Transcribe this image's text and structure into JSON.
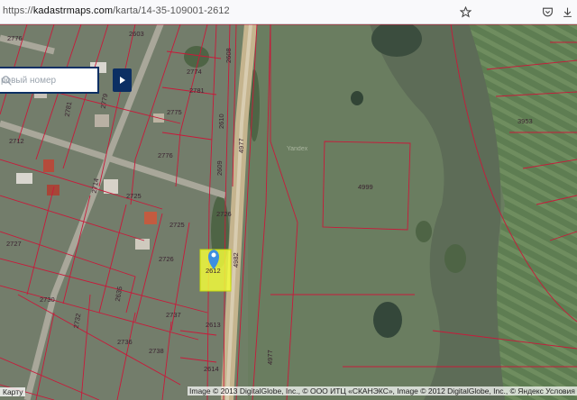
{
  "browser": {
    "url_prefix": "https://",
    "url_host": "kadastrmaps.com",
    "url_path": "/karta/14-35-109001-2612"
  },
  "search": {
    "placeholder_visible": "ровый номер"
  },
  "map": {
    "parcel_labels": [
      "2776",
      "2774",
      "2603",
      "2608",
      "2781",
      "2775",
      "2779",
      "2712",
      "2781",
      "2610",
      "2776",
      "2609",
      "2714",
      "2726",
      "2725",
      "2725",
      "2726",
      "2727",
      "2730",
      "2732",
      "2736",
      "2738",
      "2737",
      "2613",
      "2614",
      "4977",
      "4999",
      "3953",
      "2635",
      "4977",
      "4982"
    ],
    "selected_parcel_label": "2612",
    "selected_parcel_color": "#f4ff3a",
    "road_label": "4977",
    "watermark": "Yandex"
  },
  "footer": {
    "karta_label": "Карту",
    "attribution": "Image © 2013 DigitalGlobe, Inc., © ООО ИТЦ «СКАНЭКС», Image © 2012 DigitalGlobe, Inc., © Яндекс Условия и"
  }
}
